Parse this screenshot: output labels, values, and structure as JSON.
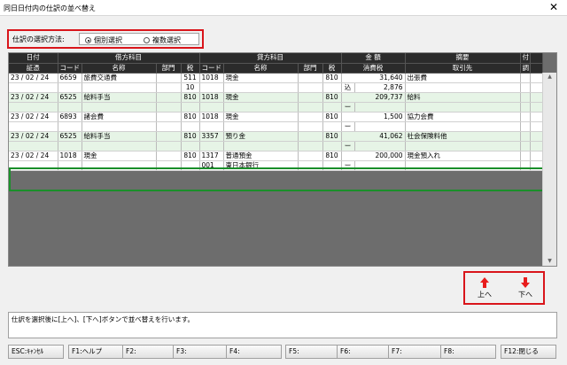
{
  "window": {
    "title": "同日日付内の仕訳の並べ替え",
    "close_glyph": "✕"
  },
  "selection_mode": {
    "label": "仕訳の選択方法:",
    "options": [
      {
        "label": "個別選択",
        "selected": true
      },
      {
        "label": "複数選択",
        "selected": false
      }
    ]
  },
  "grid": {
    "header_top": [
      "日付",
      "借方科目",
      "貸方科目",
      "金 額",
      "摘要",
      "付"
    ],
    "header_bottom": [
      "証憑",
      "コード",
      "名称",
      "部門",
      "税",
      "コード",
      "名称",
      "部門",
      "税",
      "消費税",
      "取引先",
      "調"
    ],
    "entries": [
      {
        "date": "23 / 02 / 24",
        "dr_code": "6659",
        "dr_name": "旅費交通費",
        "dr_dept": "",
        "dr_tax": "511",
        "cr_code": "1018",
        "cr_name": "現金",
        "cr_dept": "",
        "cr_tax": "810",
        "amount": "31,640",
        "memo": "出張費",
        "voucher": "",
        "dr_tax2": "10",
        "cr_code2": "",
        "cr_name2": "",
        "tax_flag": "込",
        "tax_amount": "2,876",
        "partner": "",
        "selected": false
      },
      {
        "date": "23 / 02 / 24",
        "dr_code": "6525",
        "dr_name": "給料手当",
        "dr_dept": "",
        "dr_tax": "810",
        "cr_code": "1018",
        "cr_name": "現金",
        "cr_dept": "",
        "cr_tax": "810",
        "amount": "209,737",
        "memo": "給料",
        "voucher": "",
        "dr_tax2": "",
        "cr_code2": "",
        "cr_name2": "",
        "tax_flag": "ー",
        "tax_amount": "",
        "partner": "",
        "selected": false
      },
      {
        "date": "23 / 02 / 24",
        "dr_code": "6893",
        "dr_name": "諸会費",
        "dr_dept": "",
        "dr_tax": "810",
        "cr_code": "1018",
        "cr_name": "現金",
        "cr_dept": "",
        "cr_tax": "810",
        "amount": "1,500",
        "memo": "協力会費",
        "voucher": "",
        "dr_tax2": "",
        "cr_code2": "",
        "cr_name2": "",
        "tax_flag": "ー",
        "tax_amount": "",
        "partner": "",
        "selected": false
      },
      {
        "date": "23 / 02 / 24",
        "dr_code": "6525",
        "dr_name": "給料手当",
        "dr_dept": "",
        "dr_tax": "810",
        "cr_code": "3357",
        "cr_name": "預り金",
        "cr_dept": "",
        "cr_tax": "810",
        "amount": "41,062",
        "memo": "社会保険料他",
        "voucher": "",
        "dr_tax2": "",
        "cr_code2": "",
        "cr_name2": "",
        "tax_flag": "ー",
        "tax_amount": "",
        "partner": "",
        "selected": false
      },
      {
        "date": "23 / 02 / 24",
        "dr_code": "1018",
        "dr_name": "現金",
        "dr_dept": "",
        "dr_tax": "810",
        "cr_code": "1317",
        "cr_name": "普通預金",
        "cr_dept": "",
        "cr_tax": "810",
        "amount": "200,000",
        "memo": "現金預入れ",
        "voucher": "",
        "dr_tax2": "",
        "cr_code2": "001",
        "cr_name2": "東日本銀行",
        "tax_flag": "ー",
        "tax_amount": "",
        "partner": "",
        "selected": true
      }
    ]
  },
  "scrollbar": {
    "up_glyph": "▲",
    "down_glyph": "▼"
  },
  "move_buttons": {
    "up_label": "上へ",
    "down_label": "下へ",
    "up_icon": "red-up-arrow",
    "down_icon": "red-down-arrow",
    "arrow_color": "#e81c1c"
  },
  "message": "仕訳を選択後に[上へ]、[下へ]ボタンで並べ替えを行います。",
  "function_keys": [
    "ESC:ｷｬﾝｾﾙ",
    "F1:ヘルプ",
    "F2:",
    "F3:",
    "F4:",
    "F5:",
    "F6:",
    "F7:",
    "F8:",
    "F12:閉じる"
  ],
  "colors": {
    "selected_outline": "#1a8f2a",
    "highlight_frame": "#d9151b",
    "alt_row": "#e6f4e6",
    "header_bg": "#2b2b2b"
  }
}
